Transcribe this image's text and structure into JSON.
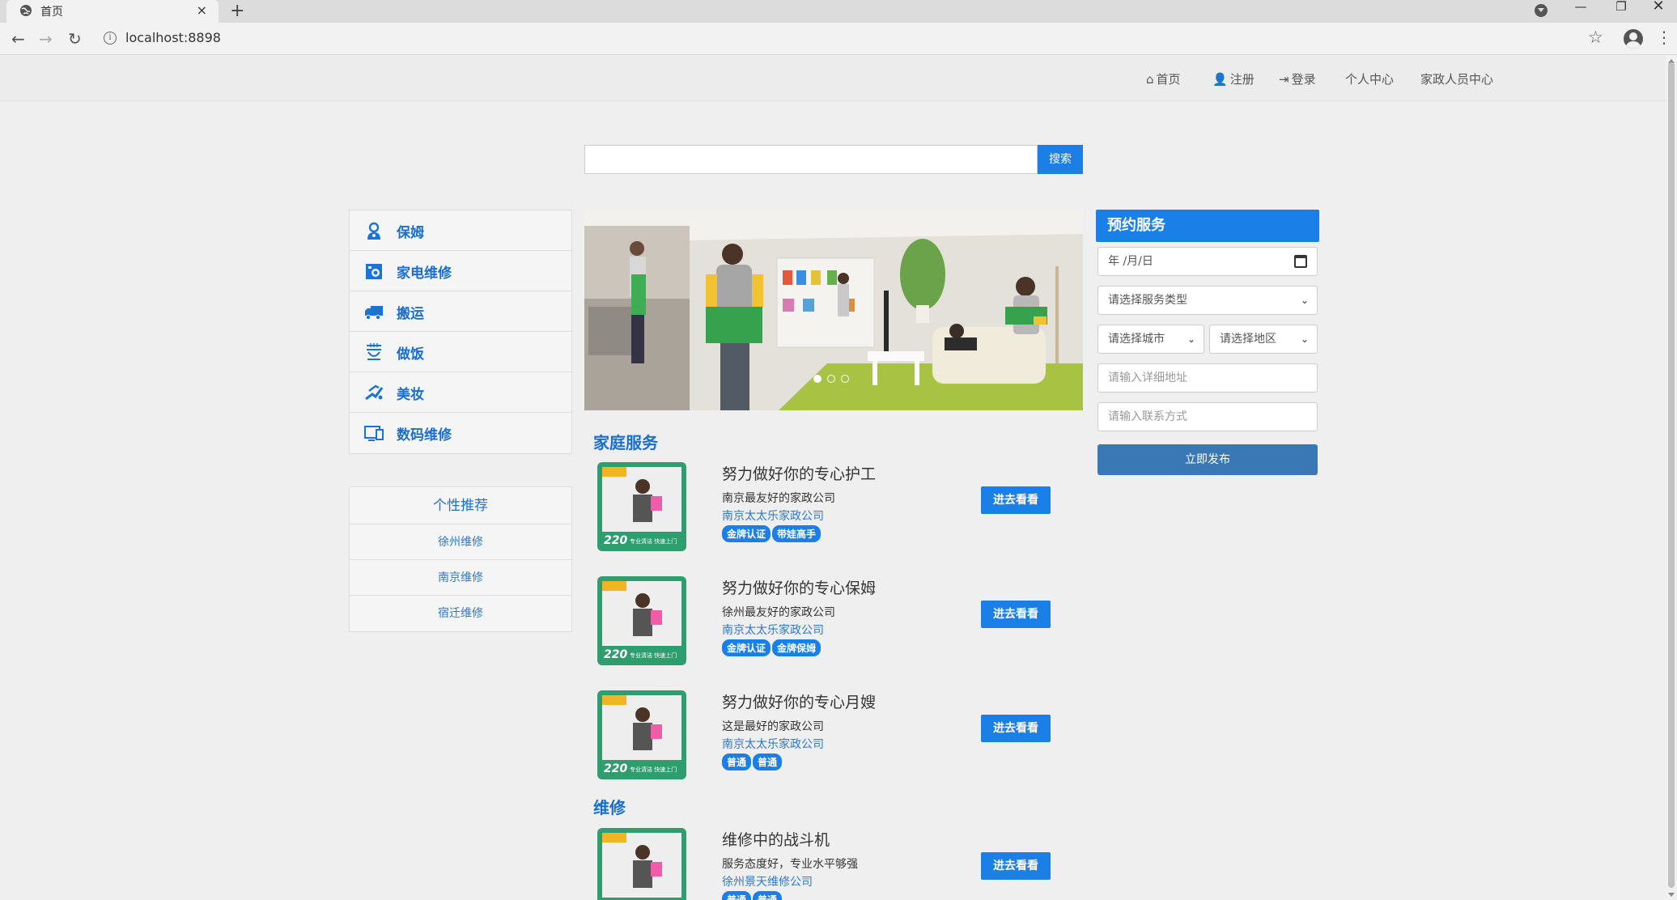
{
  "browser": {
    "tab_title": "首页",
    "tab_close": "×",
    "new_tab": "+",
    "url": "localhost:8898"
  },
  "topnav": {
    "home": "首页",
    "register": "注册",
    "login": "登录",
    "personal": "个人中心",
    "staff": "家政人员中心"
  },
  "search": {
    "placeholder": "",
    "button": "搜索"
  },
  "categories": [
    {
      "label": "保姆",
      "icon": "nanny-icon"
    },
    {
      "label": "家电维修",
      "icon": "appliance-repair-icon"
    },
    {
      "label": "搬运",
      "icon": "truck-icon"
    },
    {
      "label": "做饭",
      "icon": "cooking-icon"
    },
    {
      "label": "美妆",
      "icon": "makeup-icon"
    },
    {
      "label": "数码维修",
      "icon": "digital-repair-icon"
    }
  ],
  "recommend": {
    "title": "个性推荐",
    "items": [
      "徐州维修",
      "南京维修",
      "宿迁维修"
    ]
  },
  "banner": {
    "slides": 3,
    "active_slide": 1
  },
  "sections": [
    {
      "title": "家庭服务",
      "listings": [
        {
          "title": "努力做好你的专心护工",
          "desc": "南京最友好的家政公司",
          "company": "南京太太乐家政公司",
          "tags": [
            "金牌认证",
            "带娃高手"
          ],
          "button": "进去看看"
        },
        {
          "title": "努力做好你的专心保姆",
          "desc": "徐州最友好的家政公司",
          "company": "南京太太乐家政公司",
          "tags": [
            "金牌认证",
            "金牌保姆"
          ],
          "button": "进去看看"
        },
        {
          "title": "努力做好你的专心月嫂",
          "desc": "这是最好的家政公司",
          "company": "南京太太乐家政公司",
          "tags": [
            "普通",
            "普通"
          ],
          "button": "进去看看"
        }
      ]
    },
    {
      "title": "维修",
      "listings": [
        {
          "title": "维修中的战斗机",
          "desc": "服务态度好，专业水平够强",
          "company": "徐州景天维修公司",
          "tags": [
            "普通",
            "普通"
          ],
          "button": "进去看看"
        }
      ]
    }
  ],
  "thumb": {
    "badge": "220",
    "caption": "专业清洁 快速上门"
  },
  "booking": {
    "title": "预约服务",
    "date": "年 /月/日",
    "service_type": "请选择服务类型",
    "city": "请选择城市",
    "district": "请选择地区",
    "address_placeholder": "请输入详细地址",
    "contact_placeholder": "请输入联系方式",
    "submit": "立即发布"
  },
  "colors": {
    "accent": "#1a7fe6",
    "link": "#1a6fce",
    "submit": "#3a78b5",
    "page_bg": "#efefef"
  }
}
